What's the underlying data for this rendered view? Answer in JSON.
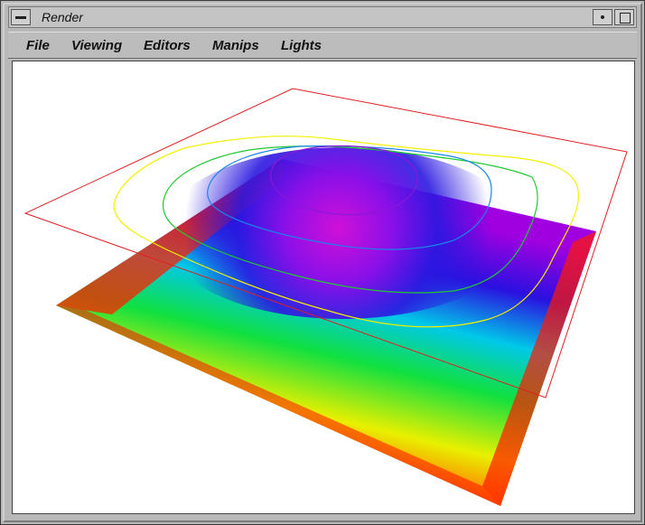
{
  "window": {
    "title": "Render"
  },
  "menu": {
    "items": [
      "File",
      "Viewing",
      "Editors",
      "Manips",
      "Lights"
    ]
  },
  "colors": {
    "bounding_plane": "#e02020",
    "contours": [
      "#f4f000",
      "#22c832",
      "#1a84e8",
      "#8a18d8"
    ],
    "colormap": [
      "#ff0000",
      "#ff8000",
      "#ffff00",
      "#00ff00",
      "#00ffff",
      "#0000ff",
      "#a000ff",
      "#ff00ff"
    ]
  },
  "viewport": {
    "content": "3D surface with contour lines"
  }
}
